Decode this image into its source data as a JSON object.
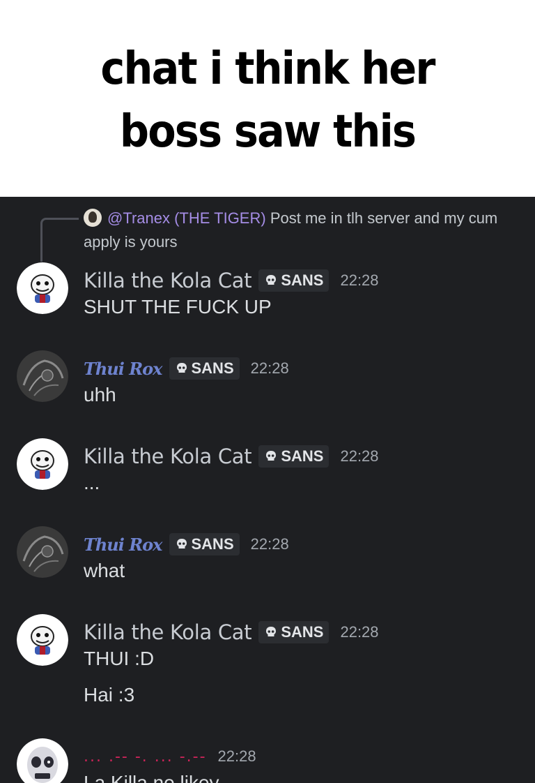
{
  "caption": {
    "text": "chat i think her boss saw this"
  },
  "reply": {
    "mention": "@Tranex (THE TIGER)",
    "text": " Post me in tlh server and my cum apply is yours"
  },
  "colors": {
    "chat_bg": "#1e1f22",
    "mention": "#a58de6",
    "fancy_name": "#6e83cf",
    "dotted_name": "#d0245a"
  },
  "messages": [
    {
      "author": "Killa the Kola Cat",
      "tag": "SANS",
      "time": "22:28",
      "lines": [
        "SHUT THE FUCK UP"
      ],
      "avatar_icon": "sans-avatar-icon"
    },
    {
      "author": "Thui Rox",
      "tag": "SANS",
      "time": "22:28",
      "lines": [
        "uhh"
      ],
      "avatar_icon": "sketch-avatar-icon"
    },
    {
      "author": "Killa the Kola Cat",
      "tag": "SANS",
      "time": "22:28",
      "lines": [
        "..."
      ],
      "avatar_icon": "sans-avatar-icon"
    },
    {
      "author": "Thui Rox",
      "tag": "SANS",
      "time": "22:28",
      "lines": [
        "what"
      ],
      "avatar_icon": "sketch-avatar-icon"
    },
    {
      "author": "Killa the Kola Cat",
      "tag": "SANS",
      "time": "22:28",
      "lines": [
        "THUI :D",
        "Hai :3"
      ],
      "avatar_icon": "sans-avatar-icon"
    },
    {
      "author": "... .-- -. ... -.--",
      "time": "22:28",
      "lines": [
        "La Killa no likey"
      ],
      "avatar_icon": "skull-avatar-icon"
    }
  ]
}
